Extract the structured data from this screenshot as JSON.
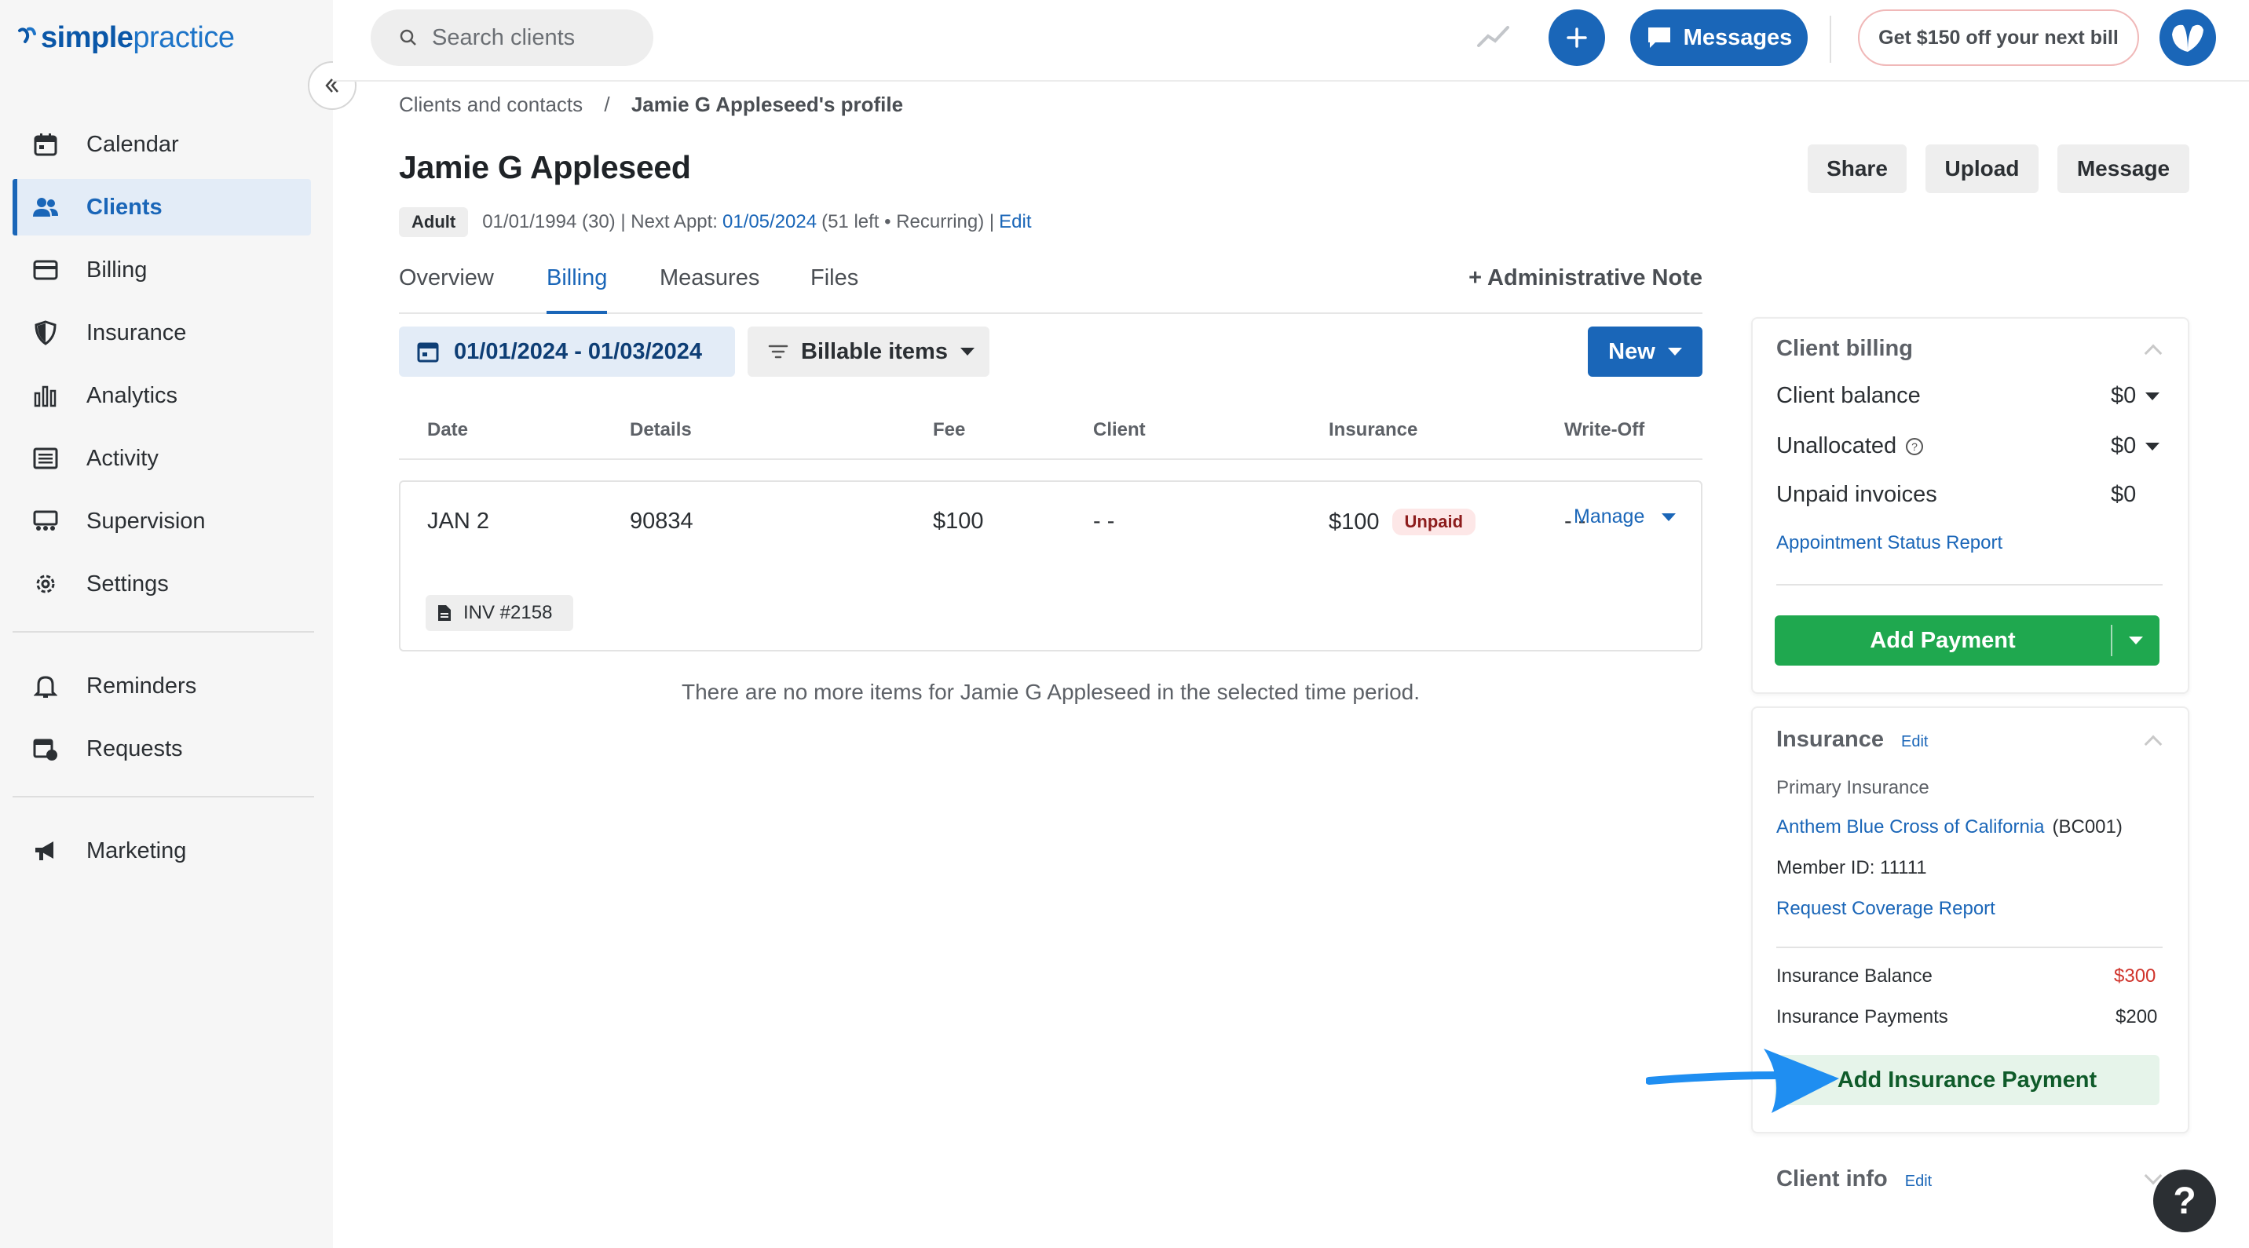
{
  "app": {
    "logo_text_a": "simple",
    "logo_text_b": "practice"
  },
  "sidebar": {
    "items": [
      {
        "label": "Calendar",
        "icon": "calendar-icon",
        "active": false
      },
      {
        "label": "Clients",
        "icon": "clients-icon",
        "active": true
      },
      {
        "label": "Billing",
        "icon": "billing-icon",
        "active": false
      },
      {
        "label": "Insurance",
        "icon": "shield-icon",
        "active": false
      },
      {
        "label": "Analytics",
        "icon": "analytics-icon",
        "active": false
      },
      {
        "label": "Activity",
        "icon": "activity-icon",
        "active": false
      },
      {
        "label": "Supervision",
        "icon": "supervision-icon",
        "active": false
      },
      {
        "label": "Settings",
        "icon": "gear-icon",
        "active": false
      },
      {
        "label": "Reminders",
        "icon": "bell-icon",
        "active": false
      },
      {
        "label": "Requests",
        "icon": "requests-icon",
        "active": false
      },
      {
        "label": "Marketing",
        "icon": "megaphone-icon",
        "active": false
      }
    ]
  },
  "topbar": {
    "search_placeholder": "Search clients",
    "messages_label": "Messages",
    "promo_label": "Get $150 off your next bill"
  },
  "breadcrumb": {
    "parent": "Clients and contacts",
    "separator": "/",
    "current": "Jamie G Appleseed's profile"
  },
  "client": {
    "name": "Jamie G Appleseed",
    "age_badge": "Adult",
    "dob_text": "01/01/1994 (30) | Next Appt:",
    "next_appt": "01/05/2024",
    "appt_meta": "(51 left • Recurring) |",
    "edit_label": "Edit"
  },
  "header_buttons": {
    "share": "Share",
    "upload": "Upload",
    "message": "Message"
  },
  "tabs": [
    "Overview",
    "Billing",
    "Measures",
    "Files"
  ],
  "active_tab": "Billing",
  "admin_note_label": "+ Administrative Note",
  "filters": {
    "date_range": "01/01/2024 - 01/03/2024",
    "billable": "Billable items",
    "new_label": "New"
  },
  "table": {
    "headers": [
      "Date",
      "Details",
      "Fee",
      "Client",
      "Insurance",
      "Write-Off"
    ],
    "row": {
      "date": "JAN 2",
      "details": "90834",
      "fee": "$100",
      "client": "- -",
      "insurance": "$100",
      "status": "Unpaid",
      "writeoff": "- -",
      "manage": "Manage",
      "invoice": "INV #2158"
    },
    "empty_message": "There are no more items for Jamie G Appleseed in the selected time period."
  },
  "client_billing": {
    "title": "Client billing",
    "client_balance_label": "Client balance",
    "client_balance": "$0",
    "unallocated_label": "Unallocated",
    "unallocated": "$0",
    "unpaid_label": "Unpaid invoices",
    "unpaid": "$0",
    "report_link": "Appointment Status Report",
    "add_payment": "Add Payment"
  },
  "insurance": {
    "title": "Insurance",
    "edit": "Edit",
    "primary_label": "Primary Insurance",
    "payer": "Anthem Blue Cross of California",
    "payer_code": "(BC001)",
    "member_id": "Member ID: 11111",
    "coverage_link": "Request Coverage Report",
    "balance_label": "Insurance Balance",
    "balance": "$300",
    "payments_label": "Insurance Payments",
    "payments": "$200",
    "add_payment": "Add Insurance Payment"
  },
  "client_info": {
    "title": "Client info",
    "edit": "Edit"
  },
  "help_label": "?",
  "colors": {
    "brand_blue": "#1a66b8",
    "green": "#1fa84f",
    "alert_red": "#d0342c",
    "arrow_blue": "#1f8ef1"
  }
}
